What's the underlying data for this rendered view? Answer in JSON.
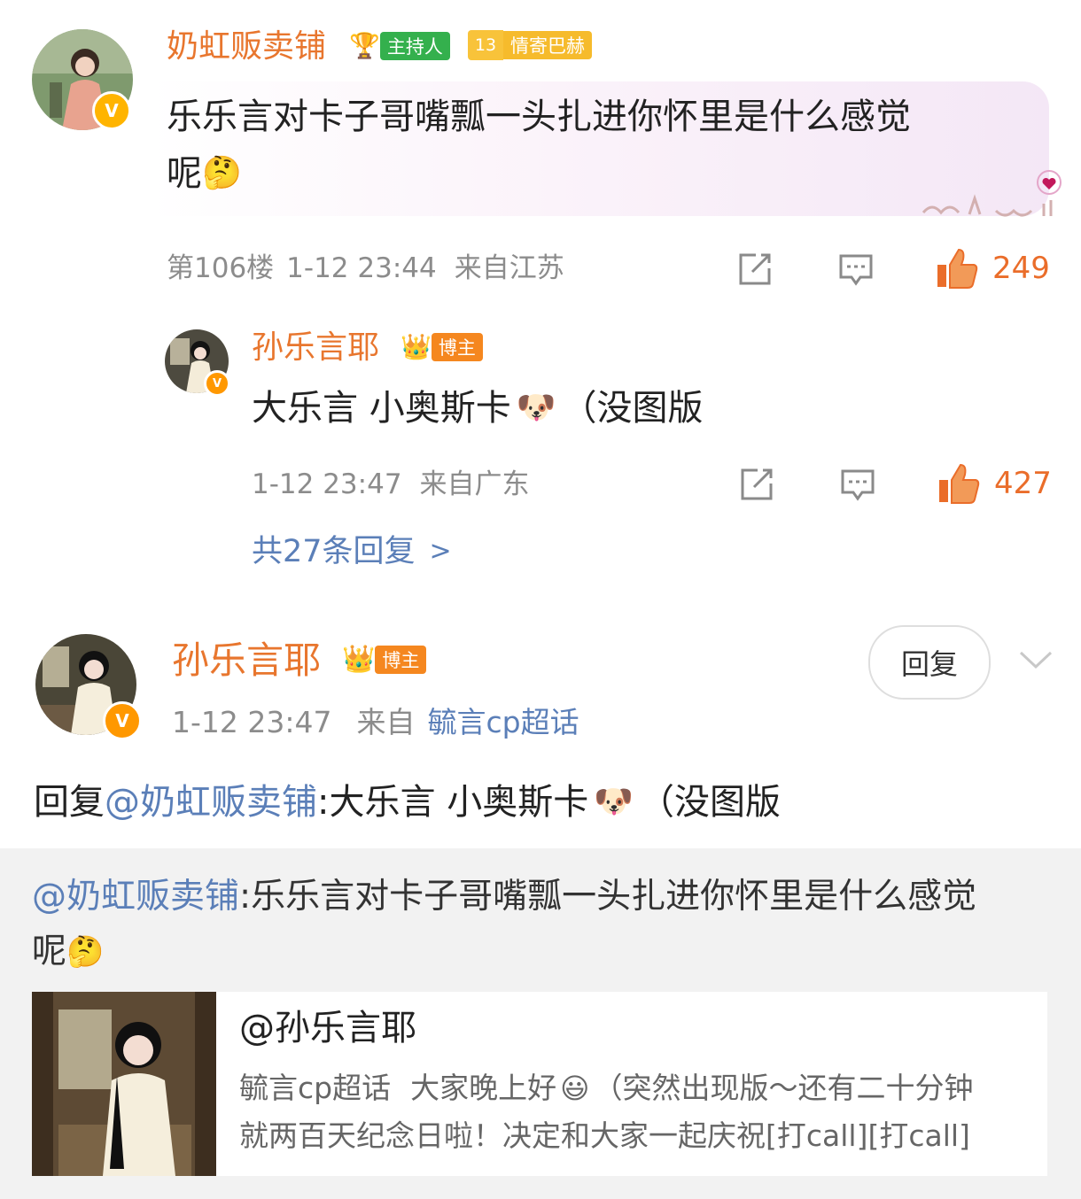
{
  "comment": {
    "username": "奶虹贩卖铺",
    "tag_host": "主持人",
    "tag_level": "13",
    "tag_fan": "情寄巴赫",
    "text_line1": "乐乐言对卡子哥嘴瓢一头扎进你怀里是什么感觉",
    "text_line2": "呢",
    "floor": "第106楼",
    "time": "1-12 23:44",
    "location": "来自江苏",
    "likes": "249"
  },
  "sub_reply": {
    "username": "孙乐言耶",
    "tag": "博主",
    "text": "大乐言 小奥斯卡",
    "text_suffix": "（没图版",
    "time": "1-12 23:47",
    "location": "来自广东",
    "likes": "427",
    "more_replies": "共27条回复",
    "more_arrow": ">"
  },
  "main_post": {
    "username": "孙乐言耶",
    "tag": "博主",
    "time": "1-12 23:47",
    "from_label": "来自",
    "source": "毓言cp超话",
    "reply_button": "回复",
    "reply_prefix": "回复",
    "mention": "@奶虹贩卖铺",
    "reply_text": ":大乐言 小奥斯卡",
    "reply_suffix": "（没图版"
  },
  "quoted": {
    "mention": "@奶虹贩卖铺",
    "text_line1": ":乐乐言对卡子哥嘴瓢一头扎进你怀里是什么感觉",
    "text_line2": "呢"
  },
  "card": {
    "title": "@孙乐言耶",
    "line1_topic": "毓言cp超话",
    "line1_text": "大家晚上好",
    "line1_rest": "（突然出现版～还有二十分钟",
    "line2": "就两百天纪念日啦！决定和大家一起庆祝[打call][打call]"
  },
  "colors": {
    "username": "#e8762e",
    "like": "#ea6d2a",
    "link": "#5b7fb8",
    "meta": "#8c8c8c"
  }
}
